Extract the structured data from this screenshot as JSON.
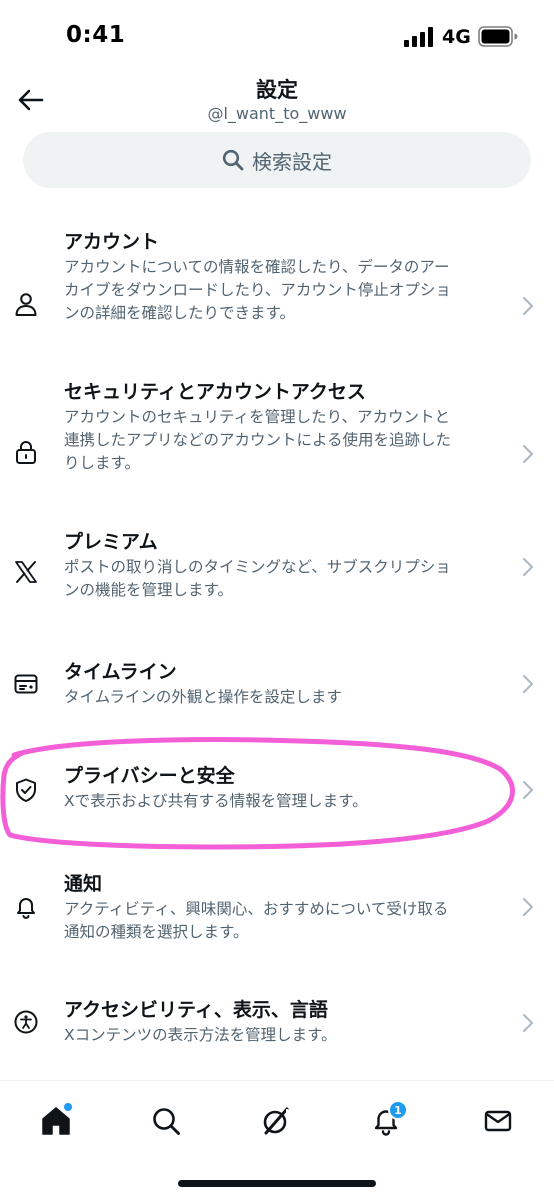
{
  "status_bar": {
    "time": "0:41",
    "network": "4G"
  },
  "header": {
    "title": "設定",
    "username": "@l_want_to_www"
  },
  "search": {
    "label": "検索設定"
  },
  "settings": [
    {
      "icon": "person-icon",
      "title": "アカウント",
      "desc_lines": [
        "アカウントについての情報を確認したり、データのアー",
        "カイブをダウンロードしたり、アカウント停止オプショ",
        "ンの詳細を確認したりできます。"
      ]
    },
    {
      "icon": "lock-icon",
      "title": "セキュリティとアカウントアクセス",
      "desc_lines": [
        "アカウントのセキュリティを管理したり、アカウントと",
        "連携したアプリなどのアカウントによる使用を追跡した",
        "りします。"
      ]
    },
    {
      "icon": "x-logo-icon",
      "title": "プレミアム",
      "desc_lines": [
        "ポストの取り消しのタイミングなど、サブスクリプショ",
        "ンの機能を管理します。"
      ]
    },
    {
      "icon": "timeline-icon",
      "title": "タイムライン",
      "desc_lines": [
        "タイムラインの外観と操作を設定します"
      ]
    },
    {
      "icon": "shield-icon",
      "title": "プライバシーと安全",
      "desc_lines": [
        "Xで表示および共有する情報を管理します。"
      ]
    },
    {
      "icon": "bell-icon",
      "title": "通知",
      "desc_lines": [
        "アクティビティ、興味関心、おすすめについて受け取る",
        "通知の種類を選択します。"
      ]
    },
    {
      "icon": "accessibility-icon",
      "title": "アクセシビリティ、表示、言語",
      "desc_lines": [
        "Xコンテンツの表示方法を管理します。"
      ]
    }
  ],
  "bottom_nav": {
    "items": [
      "home-icon",
      "search-icon",
      "grok-icon",
      "bell-icon",
      "mail-icon"
    ],
    "notification_badge": "1"
  },
  "colors": {
    "accent": "#1d9bf0",
    "highlight": "#f25fd7",
    "secondary_text": "#536471"
  }
}
